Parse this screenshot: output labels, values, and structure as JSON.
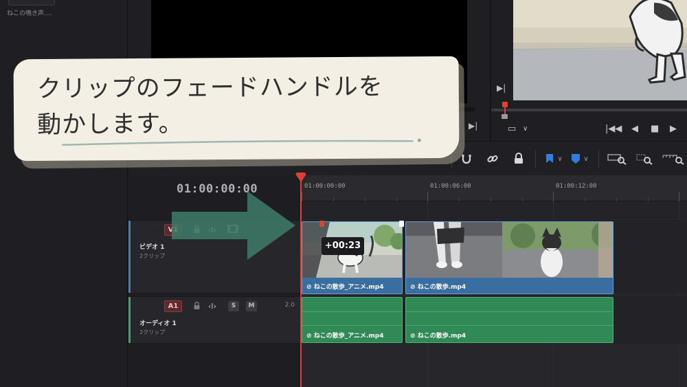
{
  "media_pool": {
    "clip_name": "ねこの鳴き声...."
  },
  "timeline": {
    "timecode": "01:00:00:00",
    "ruler_labels": [
      "01:00:00:00",
      "01:00:06:00",
      "01:00:12:00"
    ],
    "fade_offset": "+00:23",
    "tracks": {
      "video": {
        "id": "V1",
        "name": "ビデオ 1",
        "clip_count": "2クリップ",
        "clips": [
          "ねこの散歩_アニメ.mp4",
          "ねこの散歩.mp4"
        ]
      },
      "audio": {
        "id": "A1",
        "name": "オーディオ 1",
        "clip_count": "2クリップ",
        "solo_label": "S",
        "mute_label": "M",
        "volume": "2.0",
        "clips": [
          "ねこの散歩_アニメ.mp4",
          "ねこの散歩.mp4"
        ]
      }
    }
  },
  "caption": {
    "text": "クリップのフェードハンドルを\n動かします。"
  },
  "icons": {
    "lock": "lock-icon",
    "link": "link-icon",
    "magnet": "snap-icon",
    "flag": "flag-icon",
    "marker": "marker-icon",
    "zoom": "zoom-icon"
  },
  "colors": {
    "playhead": "#e0402f",
    "video_clip": "#3a6ea0",
    "audio_clip": "#2f8a56",
    "caption_bg": "#f3efe5"
  }
}
